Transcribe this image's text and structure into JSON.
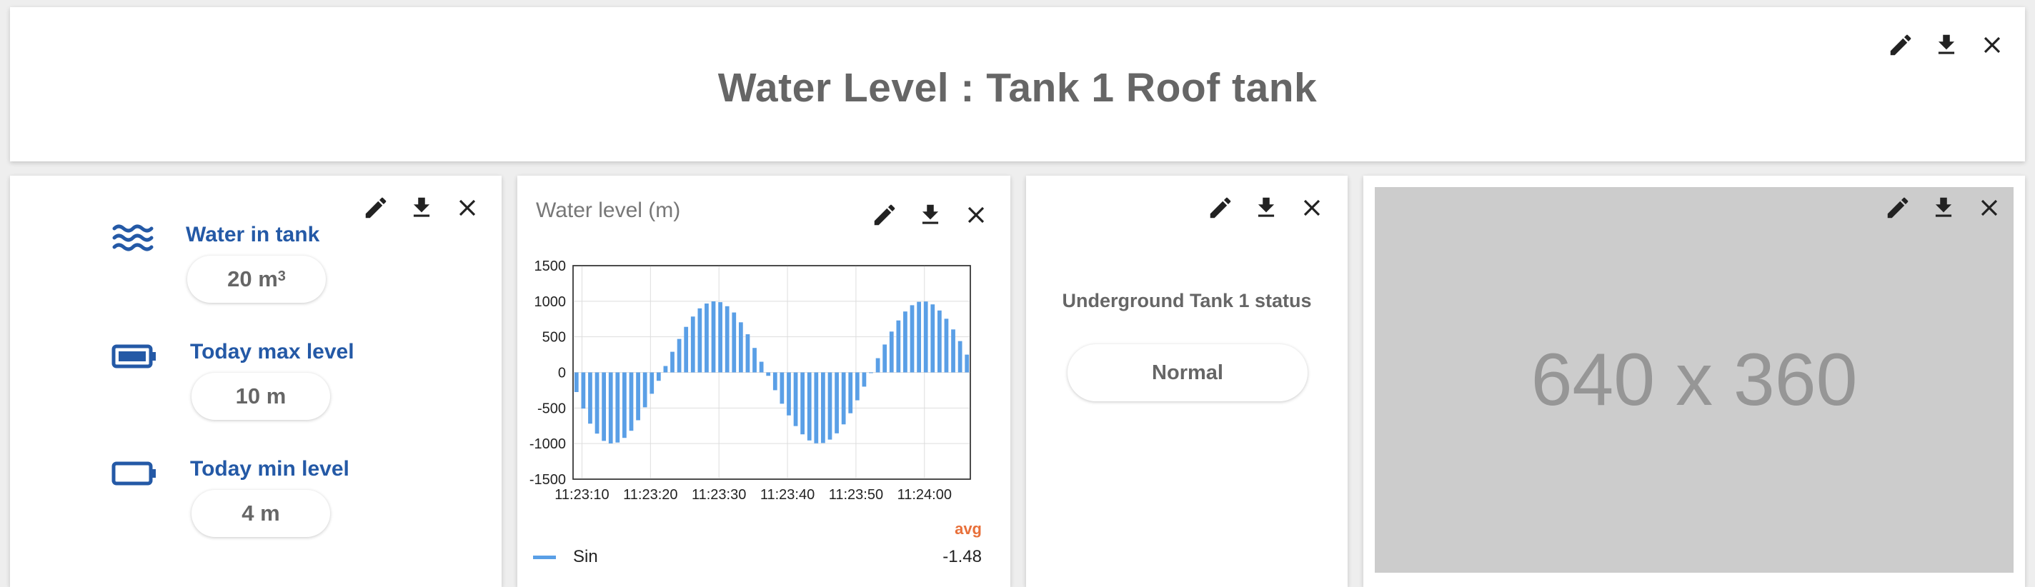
{
  "header": {
    "title": "Water Level : Tank 1 Roof tank"
  },
  "kpis": [
    {
      "label": "Water in tank",
      "value": "20 m",
      "value_sup": "3",
      "icon": "waves-icon"
    },
    {
      "label": "Today max level",
      "value": "10 m",
      "icon": "battery-full-icon"
    },
    {
      "label": "Today min level",
      "value": "4 m",
      "icon": "battery-empty-icon"
    }
  ],
  "chart": {
    "title": "Water level (m)",
    "avg_label": "avg",
    "legend": {
      "name": "Sin",
      "avg": "-1.48"
    }
  },
  "chart_data": {
    "type": "bar",
    "ylim": [
      -1500,
      1500
    ],
    "yticks": [
      "1500",
      "1000",
      "500",
      "0",
      "-500",
      "-1000",
      "-1500"
    ],
    "xticks": [
      "11:23:10",
      "11:23:20",
      "11:23:30",
      "11:23:40",
      "11:23:50",
      "11:24:00"
    ],
    "series": [
      {
        "name": "Sin",
        "color": "#5a9fe6",
        "values": [
          -276,
          -508,
          -720,
          -860,
          -962,
          -998,
          -985,
          -920,
          -820,
          -672,
          -490,
          -300,
          -118,
          90,
          290,
          470,
          640,
          785,
          900,
          968,
          998,
          987,
          930,
          842,
          704,
          536,
          344,
          150,
          -48,
          -250,
          -440,
          -604,
          -754,
          -870,
          -956,
          -996,
          -992,
          -944,
          -856,
          -730,
          -574,
          -392,
          -200,
          0,
          200,
          392,
          574,
          730,
          856,
          944,
          992,
          996,
          956,
          870,
          754,
          604,
          440,
          250
        ]
      }
    ],
    "legend_position": "bottom",
    "grid": true
  },
  "status": {
    "label": "Underground Tank 1 status",
    "value": "Normal"
  },
  "image_card": {
    "placeholder_text": "640 x 360"
  },
  "colors": {
    "accent": "#2459a6",
    "bar": "#5a9fe6",
    "avg": "#e8703a"
  }
}
